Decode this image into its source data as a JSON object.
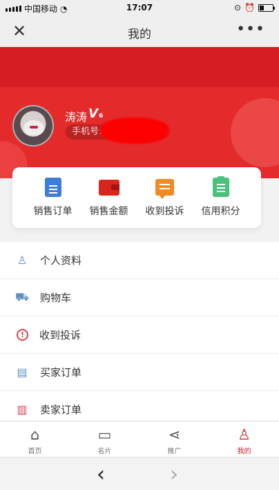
{
  "status_bar": {
    "carrier": "中国移动",
    "time": "17:07"
  },
  "header": {
    "title": "我的",
    "close_icon": "close-icon",
    "more_icon": "more-icon"
  },
  "profile": {
    "name": "涛涛",
    "vip_level": "6",
    "phone_label": "手机号:15"
  },
  "quick_actions": [
    {
      "label": "销售订单",
      "icon": "document-icon",
      "color": "#3d7ed8"
    },
    {
      "label": "销售金额",
      "icon": "wallet-icon",
      "color": "#d9261c"
    },
    {
      "label": "收到投诉",
      "icon": "chat-icon",
      "color": "#f08a24"
    },
    {
      "label": "信用积分",
      "icon": "clipboard-icon",
      "color": "#49c27b"
    }
  ],
  "menu_items": [
    {
      "label": "个人资料",
      "icon": "user-icon"
    },
    {
      "label": "购物车",
      "icon": "cart-icon"
    },
    {
      "label": "收到投诉",
      "icon": "warning-icon"
    },
    {
      "label": "买家订单",
      "icon": "clipboard-icon"
    },
    {
      "label": "卖家订单",
      "icon": "order-icon"
    }
  ],
  "tabs": [
    {
      "label": "首页",
      "icon": "home-icon"
    },
    {
      "label": "名片",
      "icon": "card-icon"
    },
    {
      "label": "推广",
      "icon": "share-icon"
    },
    {
      "label": "我的",
      "icon": "user-icon",
      "active": true
    }
  ],
  "colors": {
    "accent": "#d0212a",
    "header_red": "#e42a2a"
  }
}
